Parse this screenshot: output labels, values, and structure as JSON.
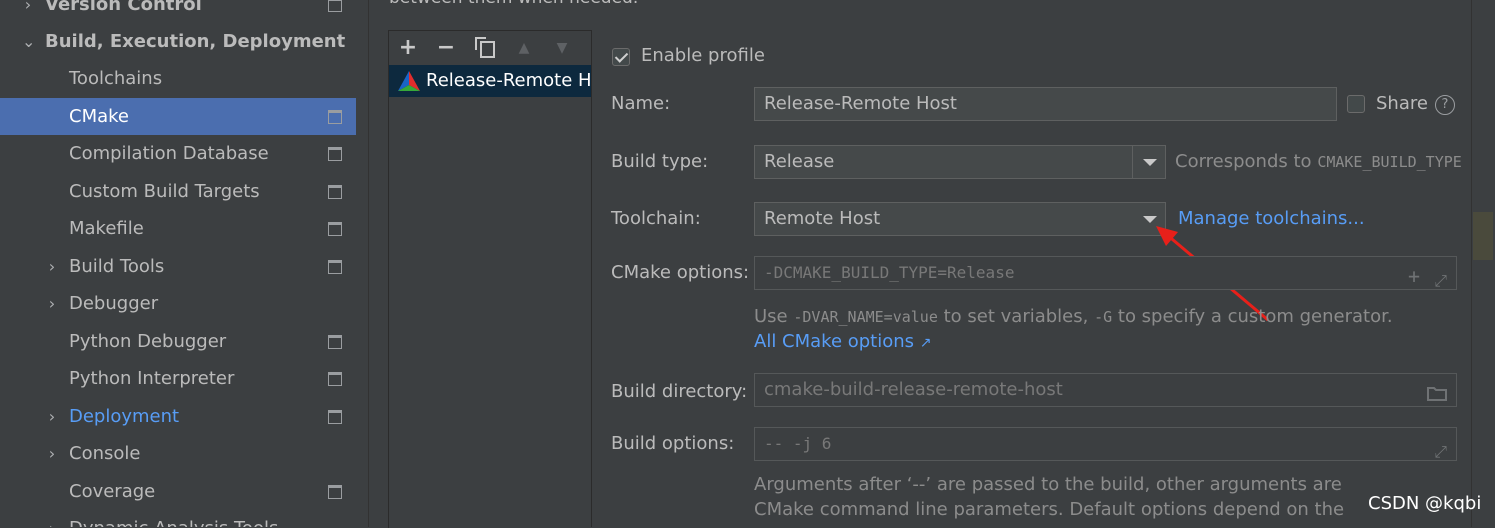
{
  "sidebar": {
    "items": [
      {
        "label": "Version Control",
        "chevron": "›",
        "doc": true
      },
      {
        "label": "Build, Execution, Deployment",
        "chevron": "⌄",
        "doc": false
      },
      {
        "label": "Toolchains",
        "chevron": "",
        "doc": false
      },
      {
        "label": "CMake",
        "chevron": "",
        "doc": true
      },
      {
        "label": "Compilation Database",
        "chevron": "",
        "doc": true
      },
      {
        "label": "Custom Build Targets",
        "chevron": "",
        "doc": true
      },
      {
        "label": "Makefile",
        "chevron": "",
        "doc": true
      },
      {
        "label": "Build Tools",
        "chevron": "›",
        "doc": true
      },
      {
        "label": "Debugger",
        "chevron": "›",
        "doc": false
      },
      {
        "label": "Python Debugger",
        "chevron": "",
        "doc": true
      },
      {
        "label": "Python Interpreter",
        "chevron": "",
        "doc": true
      },
      {
        "label": "Deployment",
        "chevron": "›",
        "doc": true
      },
      {
        "label": "Console",
        "chevron": "›",
        "doc": false
      },
      {
        "label": "Coverage",
        "chevron": "",
        "doc": true
      },
      {
        "label": "Dynamic Analysis Tools",
        "chevron": "›",
        "doc": false
      }
    ]
  },
  "main": {
    "top_text": "between them when needed."
  },
  "profiles": {
    "toolbar": {
      "add": "+",
      "remove": "−",
      "up": "▲",
      "down": "▼"
    },
    "items": [
      {
        "name": "Release-Remote Host"
      }
    ]
  },
  "profile": {
    "enable_label": "Enable profile",
    "name_label": "Name:",
    "name_value": "Release-Remote Host",
    "share_label": "Share",
    "help": "?",
    "build_type_label": "Build type:",
    "build_type_value": "Release",
    "corresponds_text": "Corresponds to",
    "corresponds_var": "CMAKE_BUILD_TYPE",
    "toolchain_label": "Toolchain:",
    "toolchain_value": "Remote Host",
    "manage_toolchains": "Manage toolchains...",
    "cmake_options_label": "CMake options:",
    "cmake_options_placeholder": "-DCMAKE_BUILD_TYPE=Release",
    "hint_use": "Use",
    "hint_var": "-DVAR_NAME=",
    "hint_value": "value",
    "hint_mid": "to set variables,",
    "hint_g": "-G",
    "hint_end": "to specify a custom generator.",
    "all_cmake_options": "All CMake options",
    "all_cmake_arrow": "↗",
    "build_dir_label": "Build directory:",
    "build_dir_placeholder": "cmake-build-release-remote-host",
    "build_options_label": "Build options:",
    "build_options_placeholder": "-- -j 6",
    "args_line1": "Arguments after ‘--’ are passed to the build, other arguments are",
    "args_line2": "CMake command line parameters. Default options depend on the"
  },
  "watermark": "CSDN @kqbi",
  "colors": {
    "selection": "#4b6eaf",
    "link": "#589df6",
    "arrow": "#e8201a"
  }
}
